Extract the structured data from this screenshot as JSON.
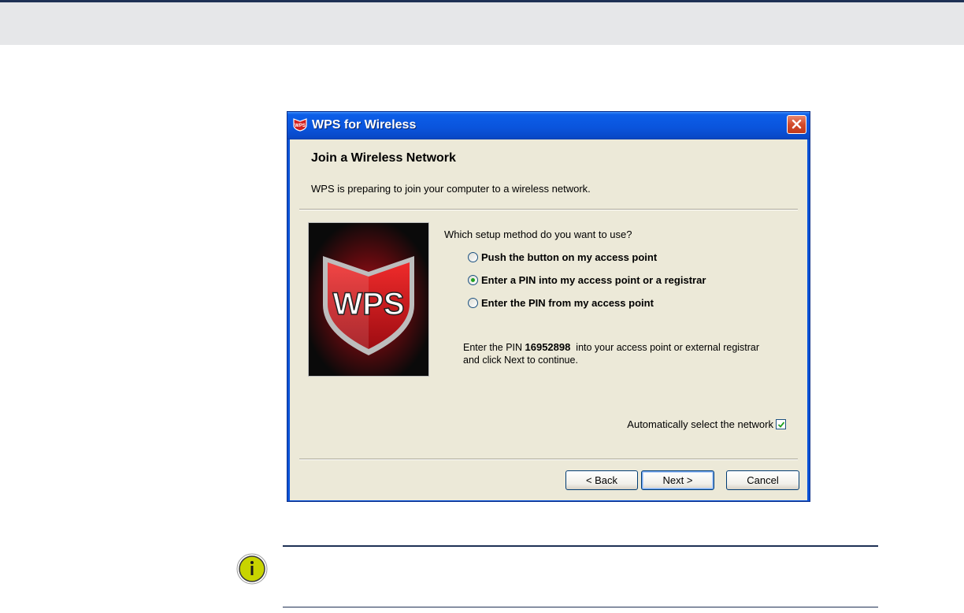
{
  "window": {
    "title": "WPS for Wireless",
    "icon": "wps-shield-icon",
    "close_icon": "close-icon"
  },
  "wizard": {
    "title": "Join a Wireless Network",
    "subtitle": "WPS is preparing to join your computer to a wireless network.",
    "image_text": "WPS"
  },
  "setup": {
    "question": "Which setup method do you want to use?",
    "options": [
      {
        "label": "Push the button on my access point",
        "selected": false
      },
      {
        "label": "Enter a PIN into my access point or a registrar",
        "selected": true
      },
      {
        "label": "Enter the PIN from my access point",
        "selected": false
      }
    ],
    "pin_prefix": "Enter the PIN ",
    "pin_value": "16952898",
    "pin_suffix": "  into your access point or external registrar",
    "pin_line2": "and click Next to continue."
  },
  "auto_select": {
    "label": "Automatically select the network",
    "checked": true
  },
  "buttons": {
    "back": "< Back",
    "next": "Next >",
    "cancel": "Cancel"
  },
  "note": {
    "icon": "info-icon"
  },
  "colors": {
    "title_bar": "#0a54dc",
    "dialog_bg": "#ece9d8",
    "page_header_band": "#e6e7e9",
    "rule": "#1f3155",
    "radio_dot": "#21a121",
    "note_icon": "#c8d400"
  }
}
